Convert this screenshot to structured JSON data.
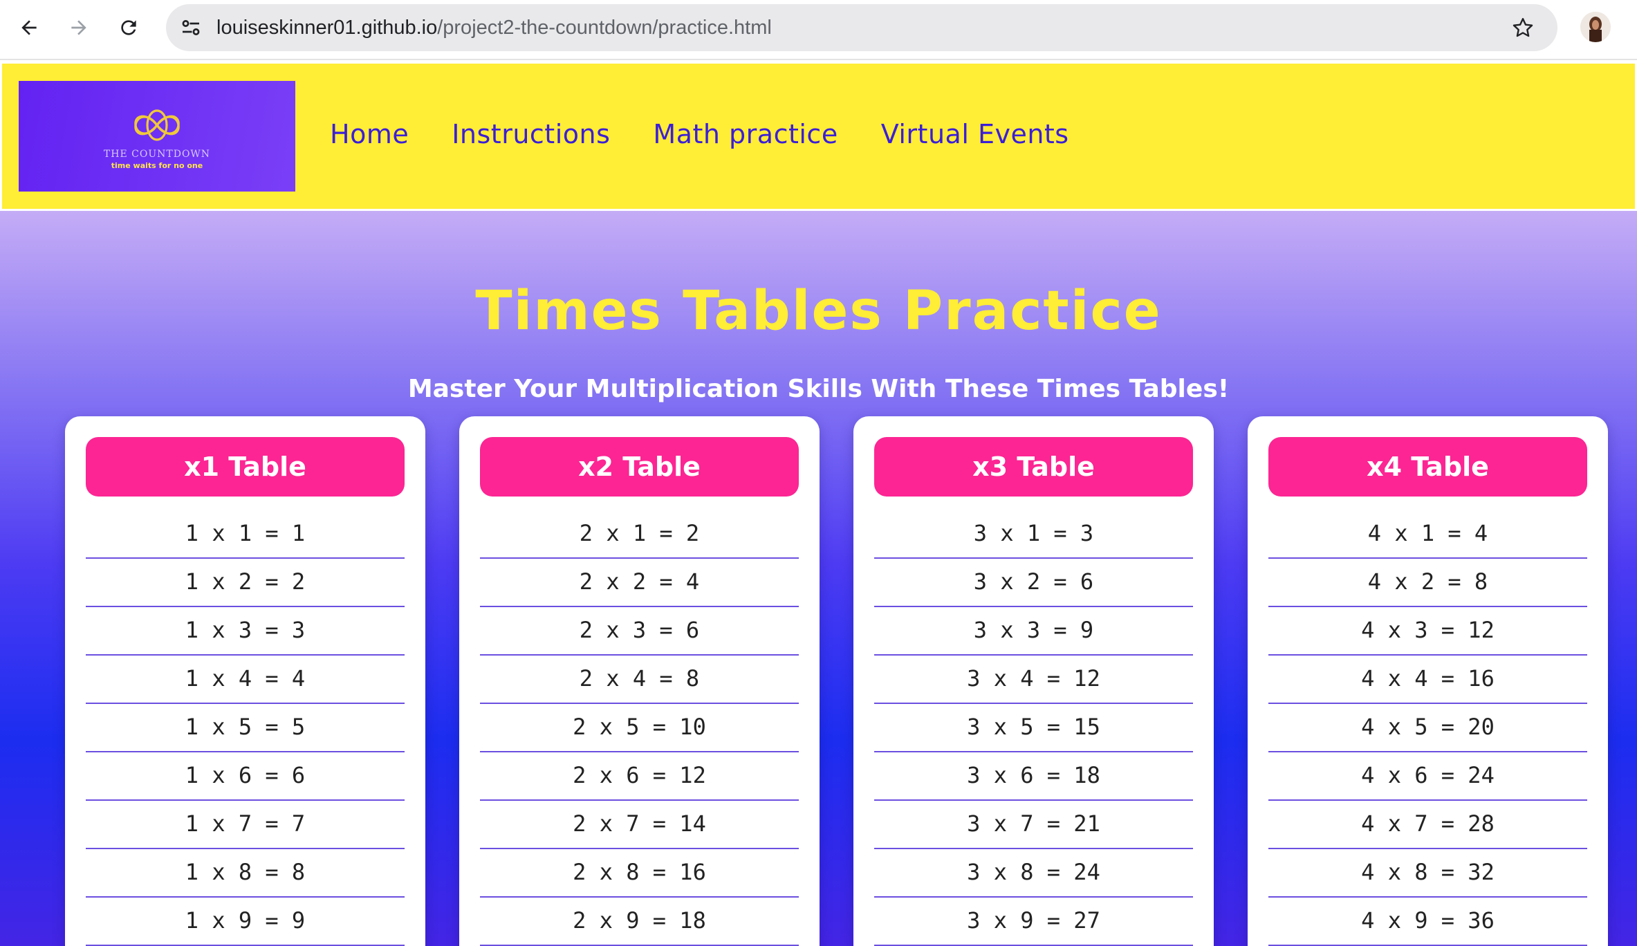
{
  "browser": {
    "url_host": "louiseskinner01.github.io",
    "url_path": "/project2-the-countdown/practice.html",
    "icons": [
      "back-arrow-icon",
      "forward-arrow-icon",
      "reload-icon",
      "site-settings-icon",
      "bookmark-star-icon",
      "profile-avatar"
    ]
  },
  "header": {
    "logo_title": "THE COUNTDOWN",
    "logo_tagline": "time waits for no one",
    "nav": [
      {
        "label": "Home"
      },
      {
        "label": "Instructions"
      },
      {
        "label": "Math practice"
      },
      {
        "label": "Virtual Events"
      }
    ]
  },
  "main": {
    "title": "Times Tables Practice",
    "subtitle": "Master Your Multiplication Skills With These Times Tables!",
    "tables": [
      {
        "heading": "x1 Table",
        "rows": [
          "1 x 1 = 1",
          "1 x 2 = 2",
          "1 x 3 = 3",
          "1 x 4 = 4",
          "1 x 5 = 5",
          "1 x 6 = 6",
          "1 x 7 = 7",
          "1 x 8 = 8",
          "1 x 9 = 9"
        ]
      },
      {
        "heading": "x2 Table",
        "rows": [
          "2 x 1 = 2",
          "2 x 2 = 4",
          "2 x 3 = 6",
          "2 x 4 = 8",
          "2 x 5 = 10",
          "2 x 6 = 12",
          "2 x 7 = 14",
          "2 x 8 = 16",
          "2 x 9 = 18"
        ]
      },
      {
        "heading": "x3 Table",
        "rows": [
          "3 x 1 = 3",
          "3 x 2 = 6",
          "3 x 3 = 9",
          "3 x 4 = 12",
          "3 x 5 = 15",
          "3 x 6 = 18",
          "3 x 7 = 21",
          "3 x 8 = 24",
          "3 x 9 = 27"
        ]
      },
      {
        "heading": "x4 Table",
        "rows": [
          "4 x 1 = 4",
          "4 x 2 = 8",
          "4 x 3 = 12",
          "4 x 4 = 16",
          "4 x 5 = 20",
          "4 x 6 = 24",
          "4 x 7 = 28",
          "4 x 8 = 32",
          "4 x 9 = 36"
        ]
      }
    ]
  },
  "colors": {
    "header_yellow": "#ffed36",
    "nav_text": "#3b1fd6",
    "card_heading_pink": "#fc2593",
    "row_divider": "#6b4fe0",
    "title_yellow": "#ffed36"
  }
}
